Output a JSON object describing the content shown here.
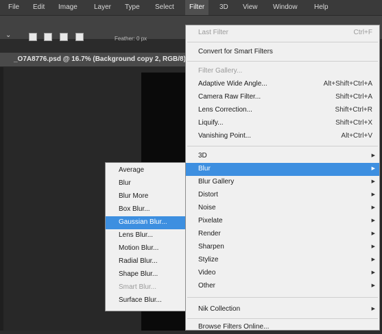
{
  "menubar": {
    "items": [
      "File",
      "Edit",
      "Image",
      "Layer",
      "Type",
      "Select",
      "Filter",
      "3D",
      "View",
      "Window",
      "Help"
    ],
    "active": "Filter"
  },
  "options": {
    "feather_label": "Feather:",
    "feather_value": "0 px"
  },
  "document": {
    "tab_title": "_O7A8776.psd @ 16.7% (Background copy 2, RGB/8)"
  },
  "filter_menu": {
    "last_filter": {
      "label": "Last Filter",
      "shortcut": "Ctrl+F"
    },
    "convert": "Convert for Smart Filters",
    "gallery": "Filter Gallery...",
    "items": [
      {
        "label": "Adaptive Wide Angle...",
        "shortcut": "Alt+Shift+Ctrl+A"
      },
      {
        "label": "Camera Raw Filter...",
        "shortcut": "Shift+Ctrl+A"
      },
      {
        "label": "Lens Correction...",
        "shortcut": "Shift+Ctrl+R"
      },
      {
        "label": "Liquify...",
        "shortcut": "Shift+Ctrl+X"
      },
      {
        "label": "Vanishing Point...",
        "shortcut": "Alt+Ctrl+V"
      }
    ],
    "submenus": [
      "3D",
      "Blur",
      "Blur Gallery",
      "Distort",
      "Noise",
      "Pixelate",
      "Render",
      "Sharpen",
      "Stylize",
      "Video",
      "Other"
    ],
    "highlighted": "Blur",
    "nik": "Nik Collection",
    "browse": "Browse Filters Online..."
  },
  "blur_submenu": {
    "items": [
      "Average",
      "Blur",
      "Blur More",
      "Box Blur...",
      "Gaussian Blur...",
      "Lens Blur...",
      "Motion Blur...",
      "Radial Blur...",
      "Shape Blur...",
      "Smart Blur...",
      "Surface Blur..."
    ],
    "highlighted": "Gaussian Blur...",
    "disabled": [
      "Smart Blur..."
    ]
  },
  "colors": {
    "highlight": "#3d8fe0",
    "menu_bg": "#f0f0f0",
    "app_bg": "#2b2b2b"
  }
}
